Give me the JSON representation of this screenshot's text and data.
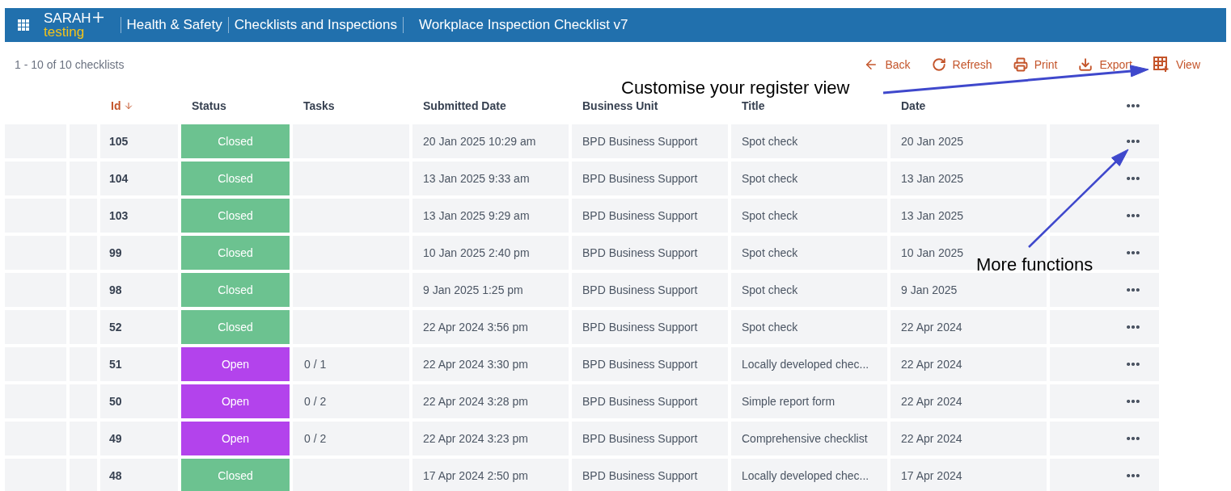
{
  "header": {
    "brand": "SARAH",
    "brand_sub": "testing",
    "breadcrumbs": [
      "Health & Safety",
      "Checklists and Inspections",
      "Workplace Inspection Checklist v7"
    ]
  },
  "toolbar": {
    "count": "1 - 10 of 10 checklists",
    "actions": [
      {
        "kind": "back",
        "label": "Back"
      },
      {
        "kind": "refresh",
        "label": "Refresh"
      },
      {
        "kind": "print",
        "label": "Print"
      },
      {
        "kind": "export",
        "label": "Export"
      },
      {
        "kind": "view",
        "label": "View"
      }
    ]
  },
  "table": {
    "columns": [
      {
        "label": "Id",
        "sorted": true
      },
      {
        "label": "Status",
        "sorted": false
      },
      {
        "label": "Tasks",
        "sorted": false
      },
      {
        "label": "Submitted Date",
        "sorted": false
      },
      {
        "label": "Business Unit",
        "sorted": false
      },
      {
        "label": "Title",
        "sorted": false
      },
      {
        "label": "Date",
        "sorted": false
      }
    ],
    "rows": [
      {
        "id": "105",
        "status": {
          "label": "Closed",
          "kind": "closed"
        },
        "tasks": "",
        "submitted": "20 Jan 2025 10:29 am",
        "business_unit": "BPD Business Support",
        "title": "Spot check",
        "date": "20 Jan 2025"
      },
      {
        "id": "104",
        "status": {
          "label": "Closed",
          "kind": "closed"
        },
        "tasks": "",
        "submitted": "13 Jan 2025 9:33 am",
        "business_unit": "BPD Business Support",
        "title": "Spot check",
        "date": "13 Jan 2025"
      },
      {
        "id": "103",
        "status": {
          "label": "Closed",
          "kind": "closed"
        },
        "tasks": "",
        "submitted": "13 Jan 2025 9:29 am",
        "business_unit": "BPD Business Support",
        "title": "Spot check",
        "date": "13 Jan 2025"
      },
      {
        "id": "99",
        "status": {
          "label": "Closed",
          "kind": "closed"
        },
        "tasks": "",
        "submitted": "10 Jan 2025 2:40 pm",
        "business_unit": "BPD Business Support",
        "title": "Spot check",
        "date": "10 Jan 2025"
      },
      {
        "id": "98",
        "status": {
          "label": "Closed",
          "kind": "closed"
        },
        "tasks": "",
        "submitted": "9 Jan 2025 1:25 pm",
        "business_unit": "BPD Business Support",
        "title": "Spot check",
        "date": "9 Jan 2025"
      },
      {
        "id": "52",
        "status": {
          "label": "Closed",
          "kind": "closed"
        },
        "tasks": "",
        "submitted": "22 Apr 2024 3:56 pm",
        "business_unit": "BPD Business Support",
        "title": "Spot check",
        "date": "22 Apr 2024"
      },
      {
        "id": "51",
        "status": {
          "label": "Open",
          "kind": "open"
        },
        "tasks": "0 / 1",
        "submitted": "22 Apr 2024 3:30 pm",
        "business_unit": "BPD Business Support",
        "title": "Locally developed chec...",
        "date": "22 Apr 2024"
      },
      {
        "id": "50",
        "status": {
          "label": "Open",
          "kind": "open"
        },
        "tasks": "0 / 2",
        "submitted": "22 Apr 2024 3:28 pm",
        "business_unit": "BPD Business Support",
        "title": "Simple report form",
        "date": "22 Apr 2024"
      },
      {
        "id": "49",
        "status": {
          "label": "Open",
          "kind": "open"
        },
        "tasks": "0 / 2",
        "submitted": "22 Apr 2024 3:23 pm",
        "business_unit": "BPD Business Support",
        "title": "Comprehensive checklist",
        "date": "22 Apr 2024"
      },
      {
        "id": "48",
        "status": {
          "label": "Closed",
          "kind": "closed"
        },
        "tasks": "",
        "submitted": "17 Apr 2024 2:50 pm",
        "business_unit": "BPD Business Support",
        "title": "Locally developed chec...",
        "date": "17 Apr 2024"
      }
    ]
  },
  "annotations": [
    "Customise your register view",
    "More functions"
  ]
}
